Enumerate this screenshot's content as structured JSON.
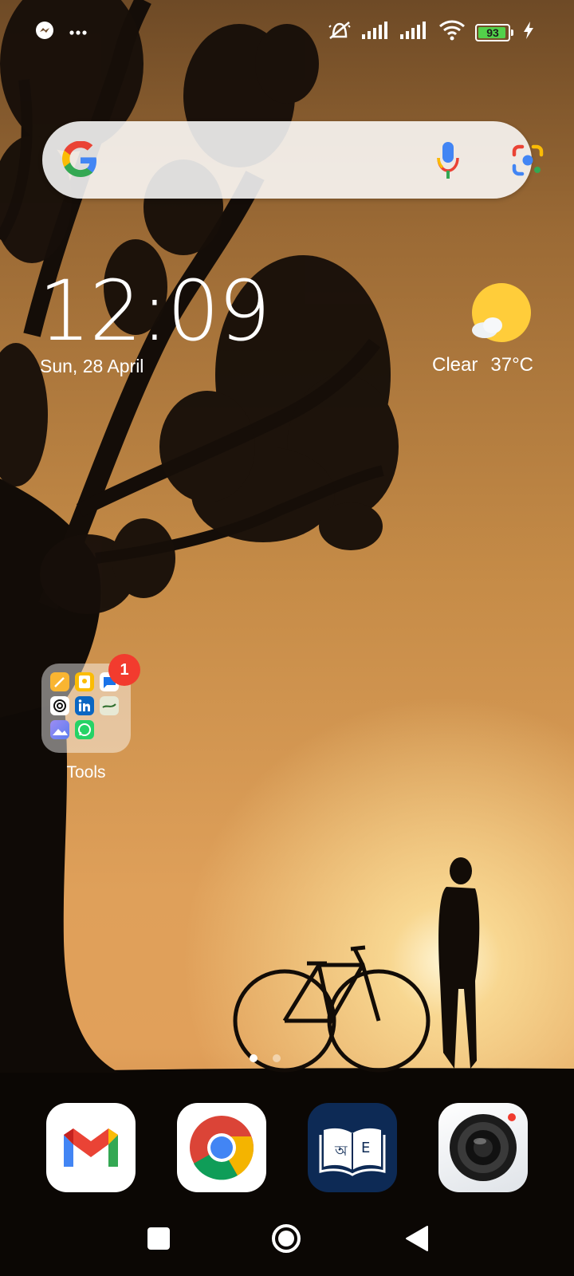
{
  "status_bar": {
    "left_icons": [
      "messenger-icon",
      "more-dots-icon"
    ],
    "right_icons": [
      "vibrate-off-icon",
      "signal-1-icon",
      "signal-2-icon",
      "wifi-icon",
      "battery-icon",
      "charging-icon"
    ],
    "battery_level": "93"
  },
  "search_widget": {
    "icons": [
      "google-logo-icon",
      "microphone-icon",
      "google-lens-icon"
    ]
  },
  "clock_widget": {
    "time": "12:09",
    "date": "Sun, 28 April"
  },
  "weather_widget": {
    "icon": "partly-sunny-icon",
    "condition": "Clear",
    "temperature": "37°C"
  },
  "folder": {
    "label": "Tools",
    "badge_count": "1",
    "apps": [
      "notes-icon",
      "keep-icon",
      "messages-icon",
      "chatgpt-icon",
      "linkedin-icon",
      "islamic-app-icon",
      "gallery-icon",
      "whatsapp-icon"
    ]
  },
  "page_indicator": {
    "count": 2,
    "active": 1
  },
  "dock": {
    "apps": [
      "gmail-icon",
      "chrome-icon",
      "bangla-english-dictionary-icon",
      "camera-icon"
    ],
    "dictionary_letters": [
      "অ",
      "E"
    ]
  },
  "nav_bar": {
    "buttons": [
      "recent-apps-button",
      "home-button",
      "back-button"
    ]
  }
}
